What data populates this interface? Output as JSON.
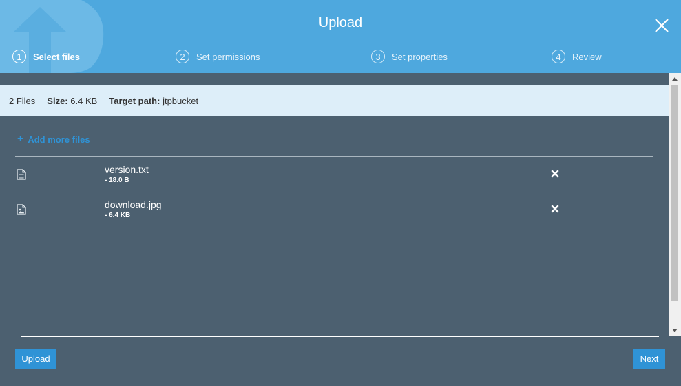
{
  "dialog": {
    "title": "Upload"
  },
  "steps": [
    {
      "number": "1",
      "label": "Select files",
      "active": true
    },
    {
      "number": "2",
      "label": "Set permissions",
      "active": false
    },
    {
      "number": "3",
      "label": "Set properties",
      "active": false
    },
    {
      "number": "4",
      "label": "Review",
      "active": false
    }
  ],
  "summary": {
    "file_count": "2 Files",
    "size_label": "Size:",
    "size_value": "6.4 KB",
    "target_label": "Target path:",
    "target_value": "jtpbucket"
  },
  "add_more": {
    "label": "Add more files"
  },
  "files": [
    {
      "name": "version.txt",
      "size": "- 18.0 B",
      "icon": "text-file-icon"
    },
    {
      "name": "download.jpg",
      "size": "- 6.4 KB",
      "icon": "image-file-icon"
    }
  ],
  "actions": {
    "upload_label": "Upload",
    "next_label": "Next"
  },
  "colors": {
    "header": "#4ea8de",
    "body": "#4c6070",
    "accent": "#2f93d6",
    "infobar": "#ddeef9"
  }
}
